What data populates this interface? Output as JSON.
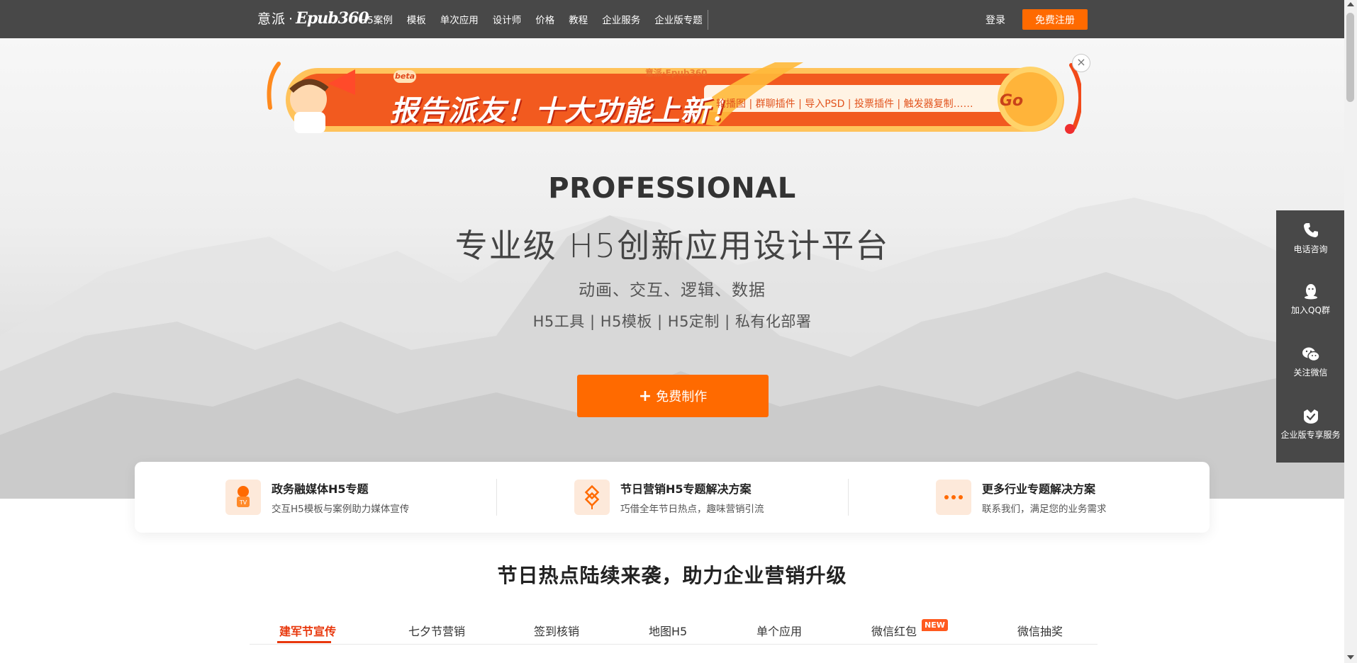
{
  "header": {
    "logo_cn": "意派",
    "logo_dot": "·",
    "logo_en": "Epub360",
    "nav": [
      "H5案例",
      "模板",
      "单次应用",
      "设计师",
      "价格",
      "教程",
      "企业服务",
      "企业版专题"
    ],
    "login": "登录",
    "register": "免费注册"
  },
  "banner": {
    "beta": "beta",
    "brand": "意派·Epub360",
    "slogan": "报告派友！十大功能上新！",
    "features": "轮播图 | 群聊插件 | 导入PSD | 投票插件 | 触发器复制……",
    "go": "Go",
    "close": "×"
  },
  "hero": {
    "title": "PROFESSIONAL",
    "subtitle": "专业级  H5创新应用设计平台",
    "tagline": "动画、交互、逻辑、数据",
    "services": "H5工具 | H5模板 | H5定制 | 私有化部署",
    "cta_icon": "+",
    "cta": "免费制作"
  },
  "solutions": [
    {
      "icon": "tv-mascot-icon",
      "title": "政务融媒体H5专题",
      "desc": "交互H5模板与案例助力媒体宣传"
    },
    {
      "icon": "chinese-knot-icon",
      "title": "节日营销H5专题解决方案",
      "desc": "巧借全年节日热点，趣味营销引流"
    },
    {
      "icon": "more-dots-icon",
      "title": "更多行业专题解决方案",
      "desc": "联系我们，满足您的业务需求"
    }
  ],
  "section_title": "节日热点陆续来袭，助力企业营销升级",
  "tabs": {
    "items": [
      "建军节宣传",
      "七夕节营销",
      "签到核销",
      "地图H5",
      "单个应用",
      "微信红包",
      "微信抽奖"
    ],
    "active_index": 0,
    "new_badge": "NEW"
  },
  "sidebar": [
    {
      "icon": "phone-icon",
      "label": "电话咨询"
    },
    {
      "icon": "qq-icon",
      "label": "加入QQ群"
    },
    {
      "icon": "wechat-icon",
      "label": "关注微信"
    },
    {
      "icon": "enterprise-service-icon",
      "label": "企业版专享服务"
    }
  ],
  "colors": {
    "accent": "#ff6a00",
    "active_tab": "#e8380d",
    "topbar": "#484848"
  }
}
